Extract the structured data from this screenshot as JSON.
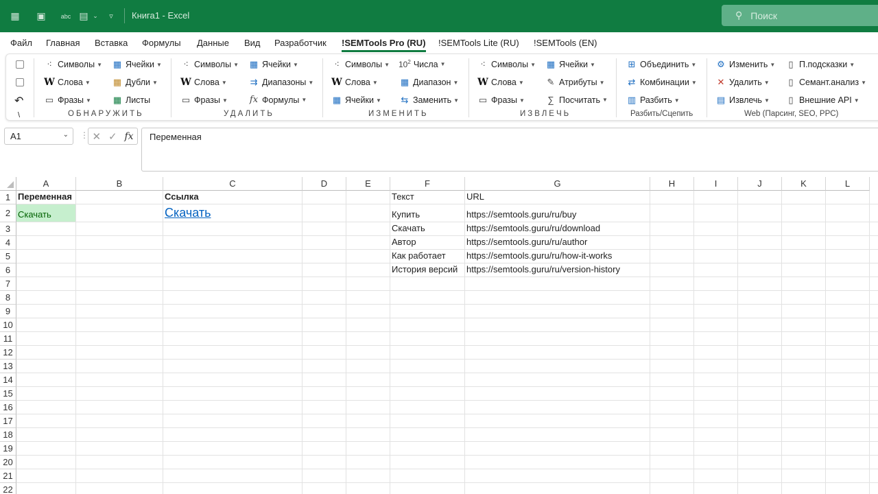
{
  "window": {
    "title": "Книга1 - Excel",
    "search_placeholder": "Поиск"
  },
  "tabs": [
    {
      "label": "Файл"
    },
    {
      "label": "Главная"
    },
    {
      "label": "Вставка"
    },
    {
      "label": "Формулы"
    },
    {
      "label": "Данные"
    },
    {
      "label": "Вид"
    },
    {
      "label": "Разработчик"
    },
    {
      "label": "!SEMTools Pro (RU)",
      "active": true
    },
    {
      "label": "!SEMTools Lite (RU)"
    },
    {
      "label": "!SEMTools (EN)"
    }
  ],
  "ribbon": {
    "misc": {
      "backslash": "\\"
    },
    "detect": {
      "label": "ОБНАРУЖИТЬ",
      "symbols": "Символы",
      "words": "Слова",
      "phrases": "Фразы",
      "cells": "Ячейки",
      "dupes": "Дубли",
      "sheets": "Листы"
    },
    "delete": {
      "label": "УДАЛИТЬ",
      "symbols": "Символы",
      "words": "Слова",
      "phrases": "Фразы",
      "cells": "Ячейки",
      "ranges": "Диапазоны",
      "formulas": "Формулы"
    },
    "change": {
      "label": "ИЗМЕНИТЬ",
      "symbols": "Символы",
      "words": "Слова",
      "cells": "Ячейки",
      "numbers_prefix": "10",
      "numbers_sup": "2",
      "numbers": "Числа",
      "range": "Диапазон",
      "replace": "Заменить"
    },
    "extract": {
      "label": "ИЗВЛЕЧЬ",
      "symbols": "Символы",
      "words": "Слова",
      "phrases": "Фразы",
      "cells": "Ячейки",
      "attributes": "Атрибуты",
      "count": "Посчитать"
    },
    "split": {
      "label": "Разбить/Сцепить",
      "merge": "Объединить",
      "combos": "Комбинации",
      "split": "Разбить"
    },
    "web": {
      "label": "Web (Парсинг, SEO, PPC)",
      "modify": "Изменить",
      "remove": "Удалить",
      "extract": "Извлечь",
      "hints": "П.подсказки",
      "semantic": "Семант.анализ",
      "api": "Внешние API"
    }
  },
  "formula_bar": {
    "name_box": "A1",
    "content": "Переменная"
  },
  "sheet": {
    "columns": [
      "A",
      "B",
      "C",
      "D",
      "E",
      "F",
      "G",
      "H",
      "I",
      "J",
      "K",
      "L"
    ],
    "rows": [
      "1",
      "2",
      "3",
      "4",
      "5",
      "6",
      "7",
      "8",
      "9",
      "10",
      "11",
      "12",
      "13",
      "14",
      "15",
      "16",
      "17",
      "18",
      "19",
      "20",
      "21",
      "22"
    ],
    "cells": {
      "A1": "Переменная",
      "C1": "Ссылка",
      "F1": "Текст",
      "G1": "URL",
      "A2": "Скачать",
      "C2": "Скачать",
      "F2": "Купить",
      "G2": "https://semtools.guru/ru/buy",
      "F3": "Скачать",
      "G3": "https://semtools.guru/ru/download",
      "F4": "Автор",
      "G4": "https://semtools.guru/ru/author",
      "F5": "Как работает",
      "G5": "https://semtools.guru/ru/how-it-works",
      "F6": "История версий",
      "G6": "https://semtools.guru/ru/version-history"
    }
  },
  "colors": {
    "brand": "#107c41",
    "good_fill": "#c6efce",
    "good_text": "#006100",
    "link": "#0563c1"
  }
}
